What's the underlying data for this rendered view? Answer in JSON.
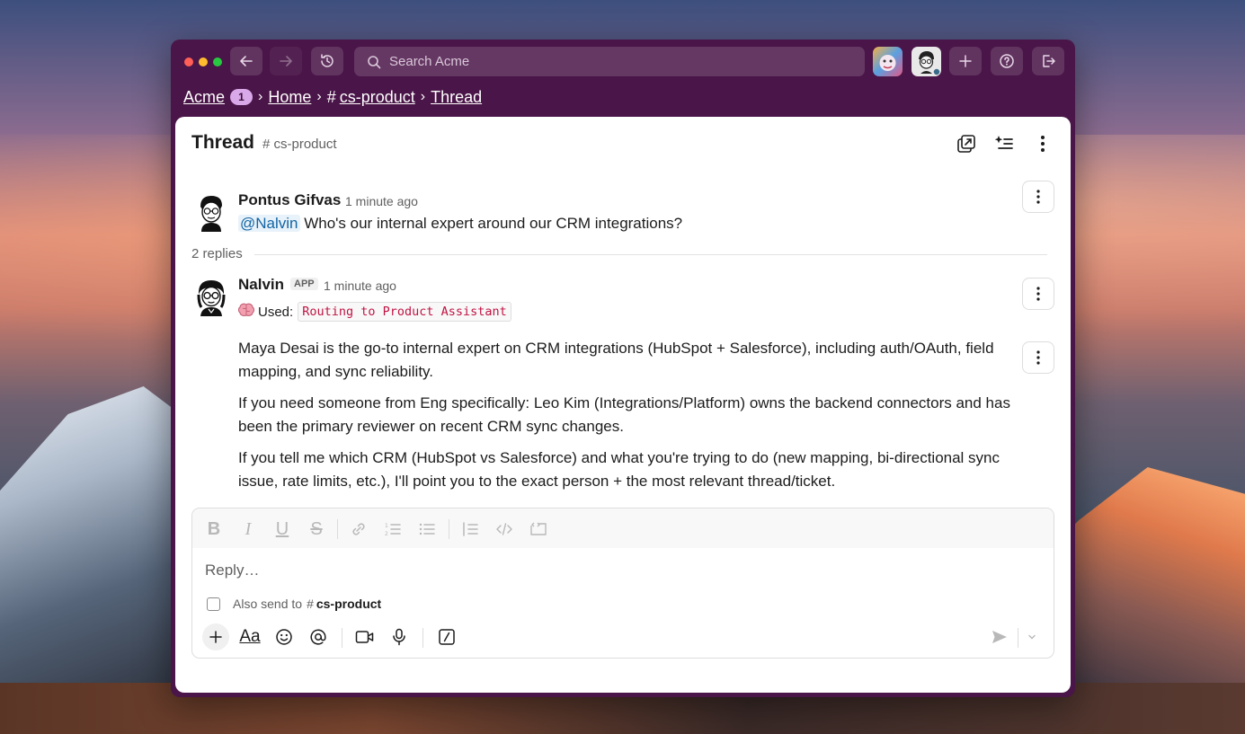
{
  "window": {
    "search_placeholder": "Search Acme"
  },
  "breadcrumb": {
    "workspace": "Acme",
    "badge": "1",
    "home": "Home",
    "channel": "cs-product",
    "thread": "Thread"
  },
  "header": {
    "title": "Thread",
    "channel": "# cs-product"
  },
  "messages": [
    {
      "author": "Pontus Gifvas",
      "time": "1 minute ago",
      "mention": "@Nalvin",
      "text": " Who's our internal expert around our CRM integrations?"
    },
    {
      "author": "Nalvin",
      "app_tag": "APP",
      "time": "1 minute ago",
      "used_label": "Used:",
      "used_tool": "Routing to Product Assistant",
      "paragraphs": [
        "Maya Desai is the go-to internal expert on CRM integrations (HubSpot + Salesforce), including auth/OAuth, field mapping, and sync reliability.",
        "If you need someone from Eng specifically: Leo Kim (Integrations/Platform) owns the backend connectors and has been the primary reviewer on recent CRM sync changes.",
        "If you tell me which CRM (HubSpot vs Salesforce) and what you're trying to do (new mapping, bi-directional sync issue, rate limits, etc.), I'll point you to the exact person + the most relevant thread/ticket."
      ]
    }
  ],
  "replies_count": "2 replies",
  "composer": {
    "placeholder": "Reply…",
    "also_send_label": "Also send to",
    "also_send_channel": "cs-product"
  },
  "colors": {
    "window_bg": "#4a1548",
    "mention_bg": "#e8f2fa",
    "mention_fg": "#1264a3",
    "code_fg": "#c01343"
  }
}
